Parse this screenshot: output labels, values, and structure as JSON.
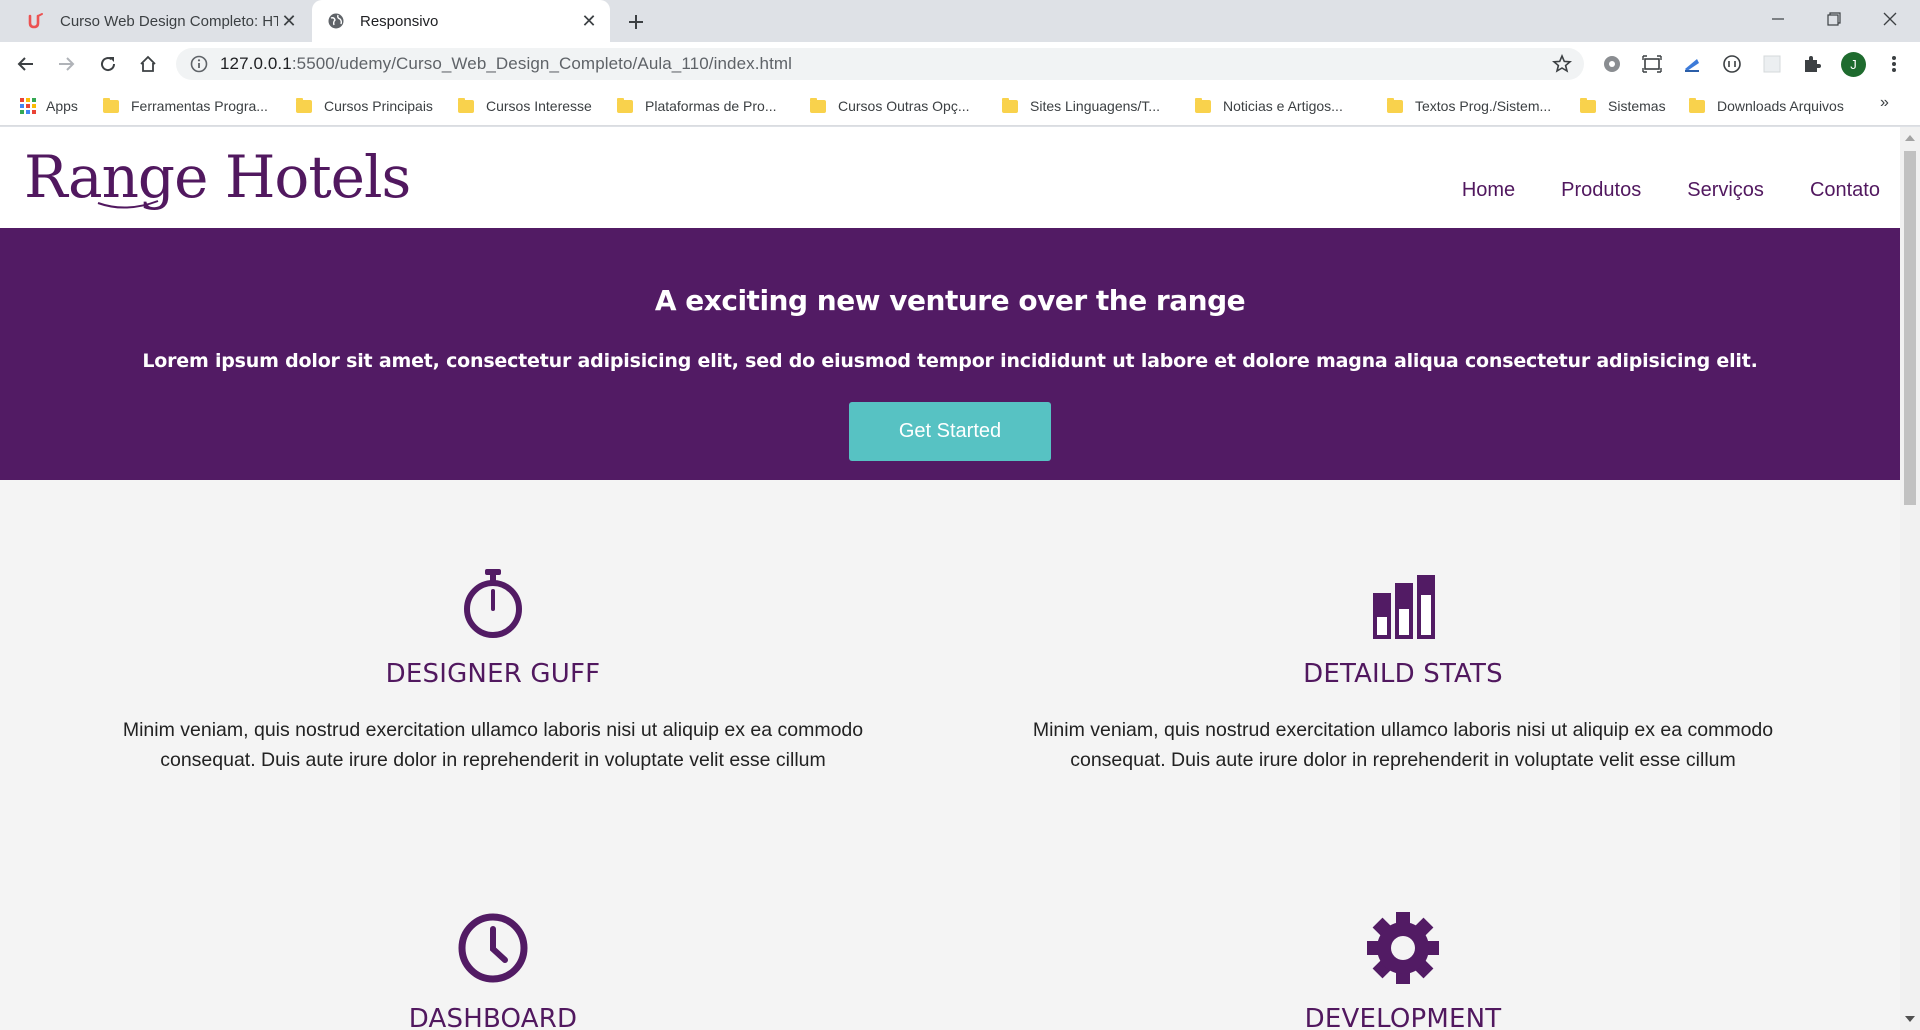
{
  "browser": {
    "tabs": [
      {
        "title": "Curso Web Design Completo: HT",
        "active": false
      },
      {
        "title": "Responsivo",
        "active": true
      }
    ],
    "url_host": "127.0.0.1",
    "url_path": ":5500/udemy/Curso_Web_Design_Completo/Aula_110/index.html",
    "avatar_letter": "J",
    "bookmarks": [
      "Apps",
      "Ferramentas Progra...",
      "Cursos Principais",
      "Cursos Interesse",
      "Plataformas de Pro...",
      "Cursos Outras Opç...",
      "Sites Linguagens/T...",
      "Noticias e Artigos...",
      "Textos Prog./Sistem...",
      "Sistemas",
      "Downloads Arquivos"
    ],
    "bookmarks_more": "»"
  },
  "site": {
    "logo": "Range Hotels",
    "nav": [
      "Home",
      "Produtos",
      "Serviços",
      "Contato"
    ],
    "hero": {
      "title": "A exciting new venture over the range",
      "text": "Lorem ipsum dolor sit amet, consectetur adipisicing elit, sed do eiusmod tempor incididunt ut labore et dolore magna aliqua consectetur adipisicing elit.",
      "cta": "Get Started"
    },
    "features": [
      {
        "icon": "stopwatch-icon",
        "title": "DESIGNER GUFF",
        "text": "Minim veniam, quis nostrud exercitation ullamco laboris nisi ut aliquip ex ea commodo consequat. Duis aute irure dolor in reprehenderit in voluptate velit esse cillum"
      },
      {
        "icon": "bar-chart-icon",
        "title": "DETAILD STATS",
        "text": "Minim veniam, quis nostrud exercitation ullamco laboris nisi ut aliquip ex ea commodo consequat. Duis aute irure dolor in reprehenderit in voluptate velit esse cillum"
      },
      {
        "icon": "clock-icon",
        "title": "DASHBOARD",
        "text": ""
      },
      {
        "icon": "gear-icon",
        "title": "DEVELOPMENT",
        "text": ""
      }
    ]
  },
  "colors": {
    "brand_purple": "#521b64",
    "cta_teal": "#57c2c3",
    "page_bg": "#f4f4f4"
  }
}
